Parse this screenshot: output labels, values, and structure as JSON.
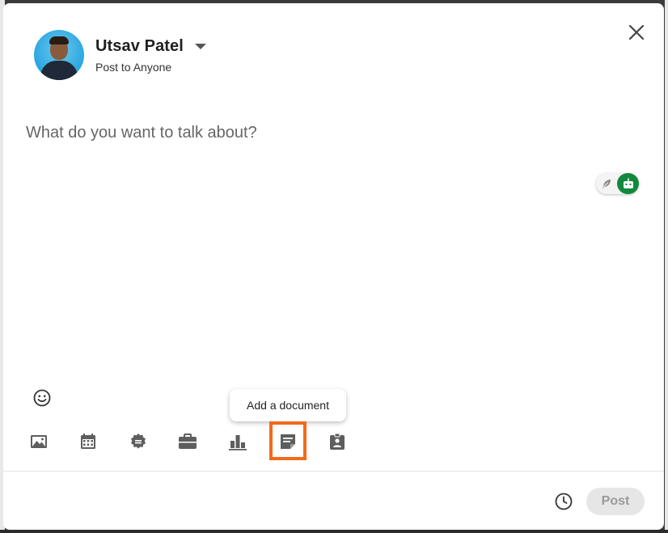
{
  "user": {
    "name": "Utsav Patel",
    "audience": "Post to Anyone"
  },
  "composer": {
    "placeholder": "What do you want to talk about?"
  },
  "tooltip": {
    "text": "Add a document"
  },
  "toolbar": {
    "icons": [
      "photo-icon",
      "event-icon",
      "celebrate-icon",
      "job-icon",
      "poll-icon",
      "document-icon",
      "service-icon"
    ]
  },
  "footer": {
    "post_label": "Post"
  },
  "colors": {
    "highlight": "#f26a1b",
    "toggle_active": "#10893e",
    "icon": "#5e5e5e"
  }
}
